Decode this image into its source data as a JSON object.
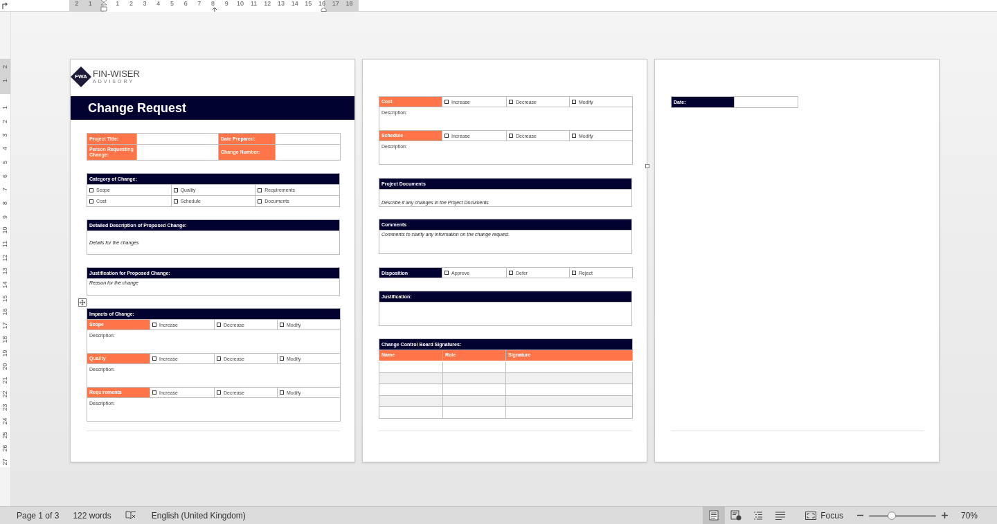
{
  "ruler": {
    "horizontal": {
      "before": [
        "2",
        "1"
      ],
      "after": [
        "1",
        "2",
        "3",
        "4",
        "5",
        "6",
        "7",
        "8",
        "9",
        "10",
        "11",
        "12",
        "13",
        "14",
        "15",
        "16",
        "17",
        "18"
      ]
    },
    "vertical": {
      "before": [
        "2",
        "1"
      ],
      "after": [
        "1",
        "2",
        "3",
        "4",
        "5",
        "6",
        "7",
        "8",
        "9",
        "10",
        "11",
        "12",
        "13",
        "14",
        "15",
        "16",
        "17",
        "18",
        "19",
        "20",
        "21",
        "22",
        "23",
        "24",
        "25",
        "26",
        "27"
      ]
    }
  },
  "pages": [
    {
      "blocks": [
        {
          "kind": "logo",
          "mark": "FWA",
          "name": "FIN-WISER",
          "tagline": "ADVISORY"
        },
        {
          "kind": "banner",
          "text": "Change Request"
        },
        {
          "kind": "fields",
          "rows": [
            {
              "cells": [
                {
                  "label": "Project Title:"
                },
                {
                  "label": "Date Prepared:"
                }
              ]
            },
            {
              "cells": [
                {
                  "label": "Person Requesting Change:"
                },
                {
                  "label": "Change Number:"
                }
              ]
            }
          ]
        },
        {
          "kind": "checkgrid",
          "title": "Category of Change:",
          "items": [
            {
              "label": "Scope",
              "checked": false
            },
            {
              "label": "Quality",
              "checked": false
            },
            {
              "label": "Requirements",
              "checked": false
            },
            {
              "label": "Cost",
              "checked": false
            },
            {
              "label": "Schedule",
              "checked": false
            },
            {
              "label": "Documents",
              "checked": false
            }
          ]
        },
        {
          "kind": "note",
          "title": "Detailed Description of Proposed Change:",
          "text": "Details for the changes"
        },
        {
          "kind": "note",
          "title": "Justification for Proposed Change:",
          "text": "Reason for the change"
        },
        {
          "kind": "impacts",
          "title": "Impacts of Change:",
          "move_handle": true,
          "areas": [
            {
              "label": "Scope",
              "options": [
                {
                  "label": "Increase",
                  "checked": false
                },
                {
                  "label": "Decrease",
                  "checked": false
                },
                {
                  "label": "Modify",
                  "checked": false
                }
              ],
              "description": "Description:"
            },
            {
              "label": "Quality",
              "options": [
                {
                  "label": "Increase",
                  "checked": false
                },
                {
                  "label": "Decrease",
                  "checked": false
                },
                {
                  "label": "Modify",
                  "checked": false
                }
              ],
              "description": "Description:"
            },
            {
              "label": "Requirements",
              "options": [
                {
                  "label": "Increase",
                  "checked": false
                },
                {
                  "label": "Decrease",
                  "checked": false
                },
                {
                  "label": "Modify",
                  "checked": false
                }
              ],
              "description": "Description:"
            }
          ]
        }
      ]
    },
    {
      "blocks": [
        {
          "kind": "impacts",
          "resize_handle": true,
          "areas": [
            {
              "label": "Cost",
              "options": [
                {
                  "label": "Increase",
                  "checked": false
                },
                {
                  "label": "Decrease",
                  "checked": false
                },
                {
                  "label": "Modify",
                  "checked": false
                }
              ],
              "description": "Description:"
            },
            {
              "label": "Schedule",
              "options": [
                {
                  "label": "Increase",
                  "checked": false
                },
                {
                  "label": "Decrease",
                  "checked": false
                },
                {
                  "label": "Modify",
                  "checked": false
                }
              ],
              "description": "Description:"
            }
          ]
        },
        {
          "kind": "note",
          "title": "Project Documents",
          "text": "Describe if any changes in the Project Documents"
        },
        {
          "kind": "note",
          "title": "Comments",
          "text": "Comments to clarify any information on the change request."
        },
        {
          "kind": "choice_row",
          "label": "Disposition",
          "options": [
            {
              "label": "Approve",
              "checked": false
            },
            {
              "label": "Defer",
              "checked": false
            },
            {
              "label": "Reject",
              "checked": false
            }
          ]
        },
        {
          "kind": "note",
          "title": "Justification:"
        },
        {
          "kind": "table",
          "title": "Change Control Board Signatures:",
          "columns": [
            "Name",
            "Role",
            "Signature"
          ],
          "rows": [
            {
              "shaded": false
            },
            {
              "shaded": true
            },
            {
              "shaded": false
            },
            {
              "shaded": true
            },
            {
              "shaded": false
            }
          ]
        }
      ]
    },
    {
      "blocks": [
        {
          "kind": "label_row",
          "label": "Date:"
        }
      ]
    }
  ],
  "status_bar": {
    "page": "Page 1 of 3",
    "words": "122 words",
    "language": "English (United Kingdom)",
    "views": [
      {
        "kind": "print",
        "selected": true
      },
      {
        "kind": "web",
        "selected": false
      },
      {
        "kind": "outline",
        "selected": false
      },
      {
        "kind": "draft",
        "selected": false
      }
    ],
    "focus": "Focus",
    "zoom": {
      "level": 0.34,
      "reading": "70%"
    }
  }
}
